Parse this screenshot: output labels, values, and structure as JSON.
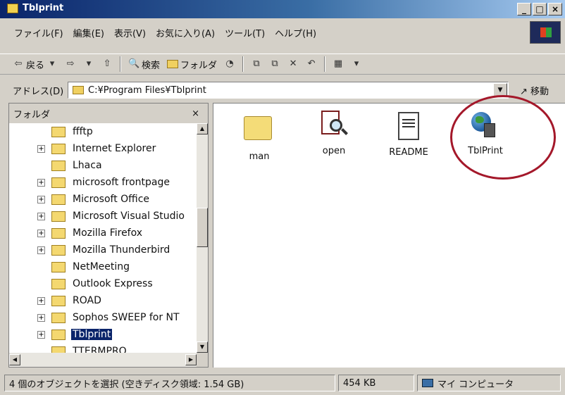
{
  "window": {
    "title": "Tblprint"
  },
  "title_buttons": [
    "_",
    "□",
    "×"
  ],
  "menu": [
    "ファイル(F)",
    "編集(E)",
    "表示(V)",
    "お気に入り(A)",
    "ツール(T)",
    "ヘルプ(H)"
  ],
  "toolbar": {
    "back": "戻る",
    "search": "検索",
    "folders": "フォルダ"
  },
  "address": {
    "label": "アドレス(D)",
    "path": "C:¥Program Files¥Tblprint",
    "go": "移動"
  },
  "folder_pane": {
    "header": "フォルダ",
    "close": "×",
    "items": [
      {
        "label": "ffftp",
        "expandable": false
      },
      {
        "label": "Internet Explorer",
        "expandable": true
      },
      {
        "label": "Lhaca",
        "expandable": false
      },
      {
        "label": "microsoft frontpage",
        "expandable": true
      },
      {
        "label": "Microsoft Office",
        "expandable": true
      },
      {
        "label": "Microsoft Visual Studio",
        "expandable": true
      },
      {
        "label": "Mozilla Firefox",
        "expandable": true
      },
      {
        "label": "Mozilla Thunderbird",
        "expandable": true
      },
      {
        "label": "NetMeeting",
        "expandable": false
      },
      {
        "label": "Outlook Express",
        "expandable": false
      },
      {
        "label": "ROAD",
        "expandable": true
      },
      {
        "label": "Sophos SWEEP for NT",
        "expandable": true
      },
      {
        "label": "Tblprint",
        "expandable": true,
        "selected": true
      },
      {
        "label": "TTERMPRO",
        "expandable": false
      }
    ]
  },
  "files": [
    {
      "name": "man",
      "icon": "folder-icon"
    },
    {
      "name": "open",
      "icon": "search-document-icon"
    },
    {
      "name": "README",
      "icon": "text-document-icon"
    },
    {
      "name": "TblPrint",
      "icon": "application-globe-icon",
      "highlighted": true
    }
  ],
  "status": {
    "selection": "4 個のオブジェクトを選択 (空きディスク領域: 1.54 GB)",
    "size": "454 KB",
    "location": "マイ コンピュータ"
  },
  "colors": {
    "title_bar": "#0a246a",
    "selection": "#0a246a",
    "highlight_ring": "#a4182a"
  }
}
